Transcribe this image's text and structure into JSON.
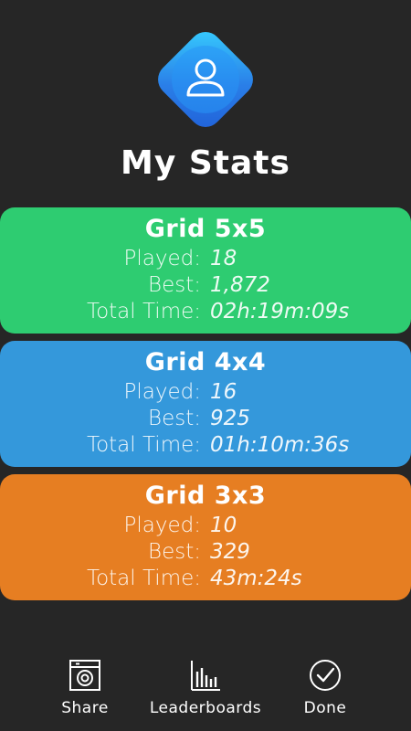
{
  "header": {
    "title": "My Stats",
    "avatar_icon": "user-profile-icon",
    "avatar_colors": [
      "#37d0ff",
      "#2060d8"
    ]
  },
  "cards": [
    {
      "title": "Grid 5x5",
      "color": "#2ecc71",
      "played_label": "Played:",
      "played": "18",
      "best_label": "Best:",
      "best": "1,872",
      "time_label": "Total Time:",
      "time": "02h:19m:09s"
    },
    {
      "title": "Grid 4x4",
      "color": "#3498db",
      "played_label": "Played:",
      "played": "16",
      "best_label": "Best:",
      "best": "925",
      "time_label": "Total Time:",
      "time": "01h:10m:36s"
    },
    {
      "title": "Grid 3x3",
      "color": "#e67e22",
      "played_label": "Played:",
      "played": "10",
      "best_label": "Best:",
      "best": "329",
      "time_label": "Total Time:",
      "time": "43m:24s"
    }
  ],
  "bottom_nav": {
    "share": {
      "label": "Share",
      "icon": "share-camera-icon"
    },
    "leaderboards": {
      "label": "Leaderboards",
      "icon": "bar-chart-icon"
    },
    "done": {
      "label": "Done",
      "icon": "checkmark-circle-icon"
    }
  }
}
